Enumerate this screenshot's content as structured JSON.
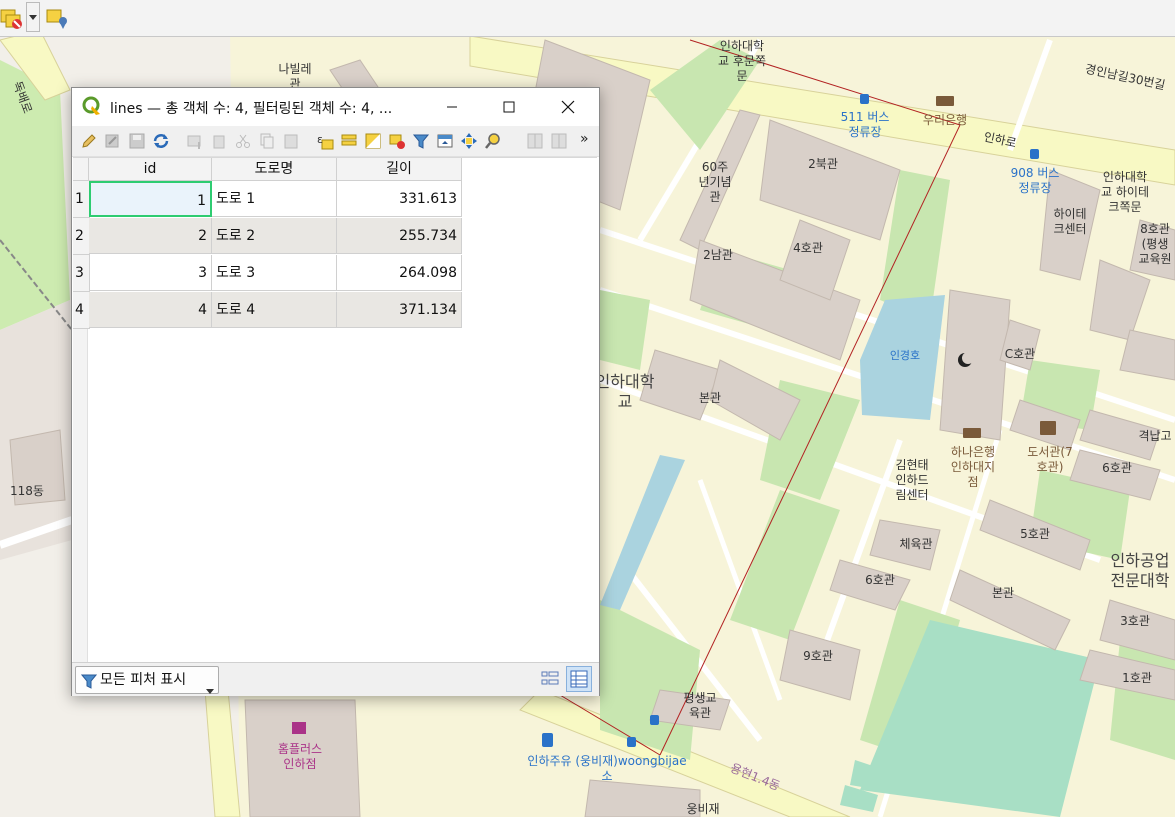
{
  "map": {
    "labels": {
      "inha_univ_back_gate": "인하대학\n교 후문쪽\n문",
      "napillet": "나빌레\n관",
      "gyeongin_road": "경인남길30번길",
      "bus_511": "511 버스\n정류장",
      "woori_bank": "우리은행",
      "inharo": "인하로",
      "bus_908": "908 버스\n정류장",
      "inha_hitech_gate": "인하대학\n교 하이테\n크쪽문",
      "hitech_center": "하이테\n크센터",
      "bldg8": "8호관\n(평생\n교육원",
      "bldg60": "60주\n년기념\n관",
      "bldg2n": "2북관",
      "bldg2s": "2남관",
      "bldg4": "4호관",
      "inha_univ": "인하대학\n교",
      "main_hall": "본관",
      "ingyeongho": "인경호",
      "bldgC": "C호관",
      "library": "도서관(7\n호관)",
      "gyeokgap": "격납고",
      "hana_bank": "하나은행\n인하대지\n점",
      "kimhyuntae": "김현태\n인하드\n림센터",
      "bldg6e": "6호관",
      "gym": "체육관",
      "bldg5": "5호관",
      "bldg6": "6호관",
      "inha_tech": "인하공업\n전문대학",
      "main_hall2": "본관",
      "bldg3": "3호관",
      "bldg9": "9호관",
      "bldg1": "1호관",
      "lifelong": "평생교\n육관",
      "gas_station": "인하주유 (웅비재)woongbijae\n소",
      "homeplus": "홈플러스\n인하점",
      "yonghyeon": "용현1.4동",
      "woongbijae": "웅비재",
      "dong118": "118동",
      "dokbaero": "독배로"
    }
  },
  "dialog": {
    "title": "lines — 총 객체 수: 4, 필터링된 객체 수: 4, ...",
    "columns": [
      "id",
      "도로명",
      "길이"
    ],
    "rows": [
      {
        "num": "1",
        "id": "1",
        "name": "도로 1",
        "length": "331.613"
      },
      {
        "num": "2",
        "id": "2",
        "name": "도로 2",
        "length": "255.734"
      },
      {
        "num": "3",
        "id": "3",
        "name": "도로 3",
        "length": "264.098"
      },
      {
        "num": "4",
        "id": "4",
        "name": "도로 4",
        "length": "371.134"
      }
    ],
    "filter_button": "모든 피처 표시",
    "more": "»"
  },
  "colors": {
    "campus": "#f8f5d8",
    "building": "#d9d0c9",
    "green": "#c8e6b0",
    "water": "#aad3df",
    "road_major": "#f7fabf",
    "line_red": "#b22222",
    "selection": "#2ecc71"
  }
}
